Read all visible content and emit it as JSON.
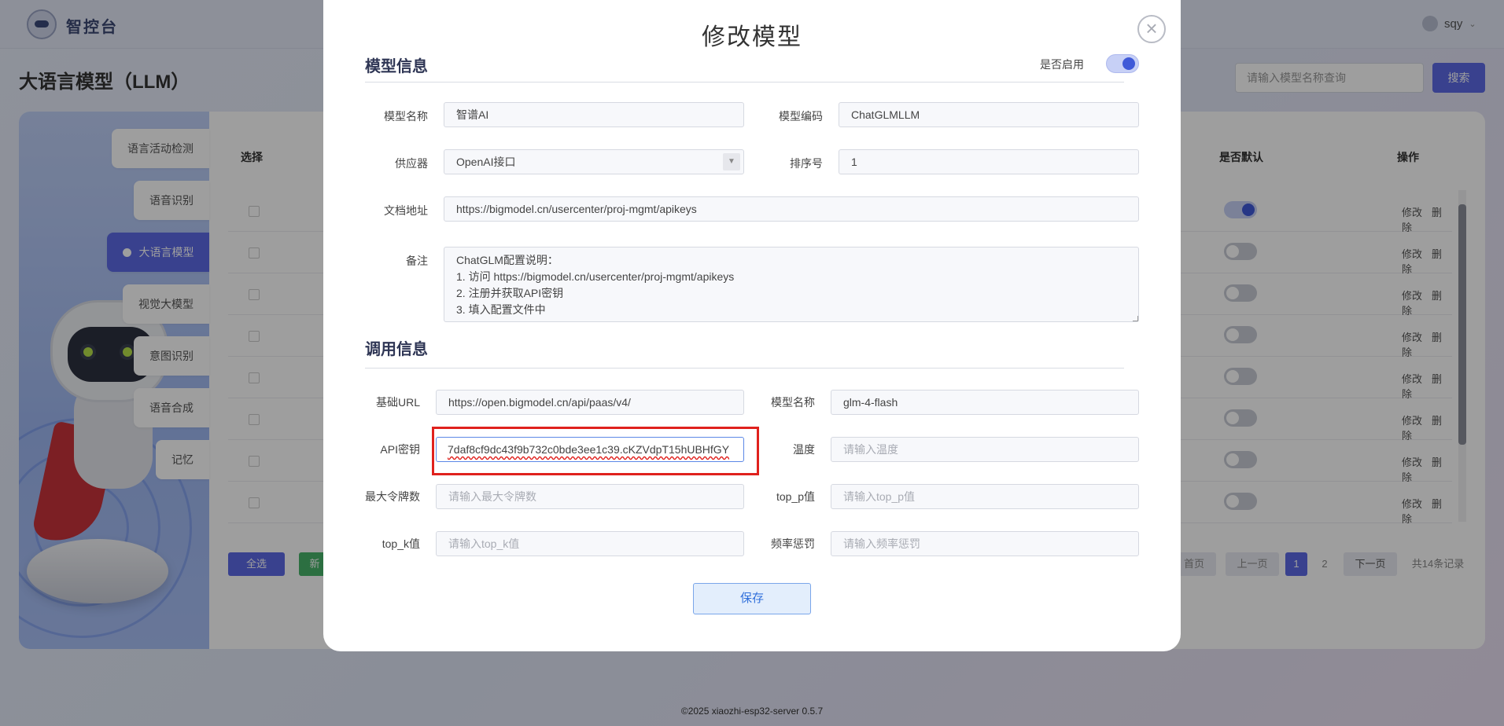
{
  "app": {
    "brand": "智控台",
    "user": "sqy",
    "page_title": "大语言模型（LLM）",
    "search": {
      "placeholder": "请输入模型名称查询",
      "button": "搜索"
    },
    "footer": "©2025 xiaozhi-esp32-server 0.5.7"
  },
  "sidebar": {
    "items": [
      {
        "label": "语言活动检测"
      },
      {
        "label": "语音识别"
      },
      {
        "label": "大语言模型",
        "active": true
      },
      {
        "label": "视觉大模型"
      },
      {
        "label": "意图识别"
      },
      {
        "label": "语音合成"
      },
      {
        "label": "记忆"
      }
    ]
  },
  "table": {
    "headers": {
      "select": "选择",
      "is_default": "是否默认",
      "actions": "操作"
    },
    "row_defaults": [
      true,
      false,
      false,
      false,
      false,
      false,
      false,
      false
    ],
    "edit_label": "修改",
    "delete_label": "删除"
  },
  "bottom": {
    "select_all": "全选",
    "second_button": "新",
    "first_page": "首页",
    "prev_page": "上一页",
    "page1": "1",
    "page2": "2",
    "next_page": "下一页",
    "total": "共14条记录"
  },
  "modal": {
    "title": "修改模型",
    "section_model": "模型信息",
    "enable_label": "是否启用",
    "enabled": true,
    "model_name_label": "模型名称",
    "model_name": "智谱AI",
    "model_code_label": "模型编码",
    "model_code": "ChatGLMLLM",
    "provider_label": "供应器",
    "provider": "OpenAI接口",
    "sort_label": "排序号",
    "sort": "1",
    "doc_label": "文档地址",
    "doc_url": "https://bigmodel.cn/usercenter/proj-mgmt/apikeys",
    "remark_label": "备注",
    "remark_lines": [
      "ChatGLM配置说明：",
      "1. 访问 https://bigmodel.cn/usercenter/proj-mgmt/apikeys",
      "2. 注册并获取API密钥",
      "3. 填入配置文件中"
    ],
    "section_call": "调用信息",
    "base_url_label": "基础URL",
    "base_url": "https://open.bigmodel.cn/api/paas/v4/",
    "call_model_label": "模型名称",
    "call_model": "glm-4-flash",
    "api_key_label": "API密钥",
    "api_key": "7daf8cf9dc43f9b732c0bde3ee1c39.cKZVdpT15hUBHfGY",
    "temperature_label": "温度",
    "temperature_placeholder": "请输入温度",
    "max_tokens_label": "最大令牌数",
    "max_tokens_placeholder": "请输入最大令牌数",
    "top_p_label": "top_p值",
    "top_p_placeholder": "请输入top_p值",
    "top_k_label": "top_k值",
    "top_k_placeholder": "请输入top_k值",
    "freq_label": "频率惩罚",
    "freq_placeholder": "请输入频率惩罚",
    "save": "保存",
    "close_icon": "×"
  },
  "colors": {
    "accent": "#5c6ae6",
    "highlight": "#e0211d",
    "save_text": "#3170db"
  }
}
